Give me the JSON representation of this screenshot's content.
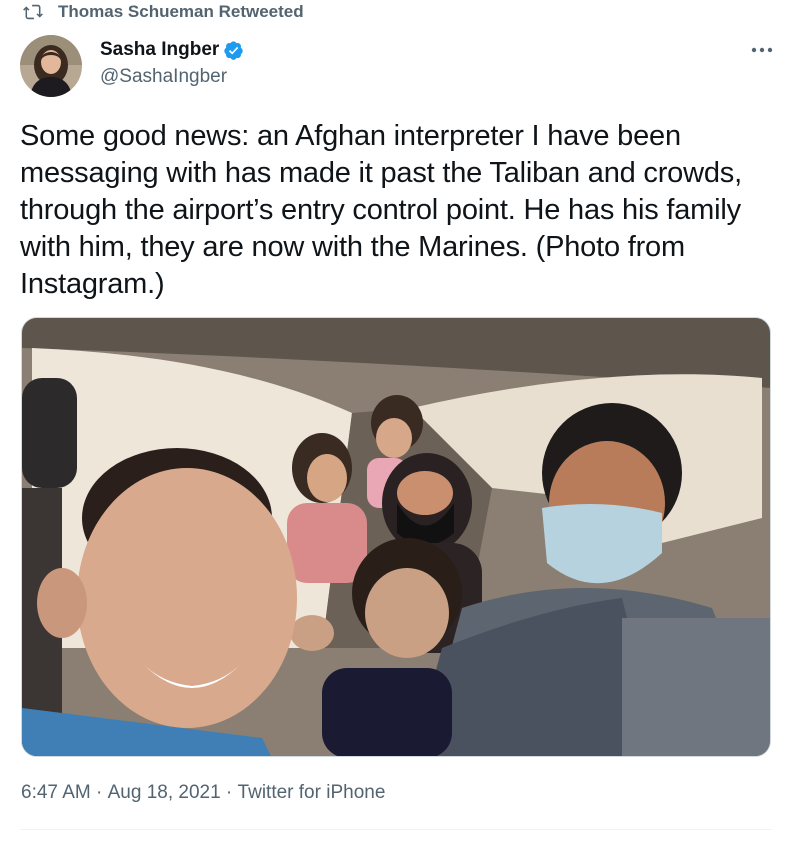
{
  "retweet": {
    "icon": "retweet-icon",
    "label": "Thomas Schueman Retweeted"
  },
  "author": {
    "name": "Sasha Ingber",
    "handle": "@SashaIngber",
    "verified": true,
    "verified_color": "#1d9bf0"
  },
  "tweet": {
    "text": "Some good news: an Afghan interpreter I have been messaging with has made it past the Taliban and crowds, through the airport’s entry control point. He has his family with him, they are now with the Marines. (Photo from Instagram.)"
  },
  "meta": {
    "time": "6:47 AM",
    "separator": " · ",
    "date": "Aug 18, 2021",
    "source": "Twitter for iPhone"
  },
  "colors": {
    "text_primary": "#0f1419",
    "text_secondary": "#536471",
    "accent": "#1d9bf0"
  }
}
